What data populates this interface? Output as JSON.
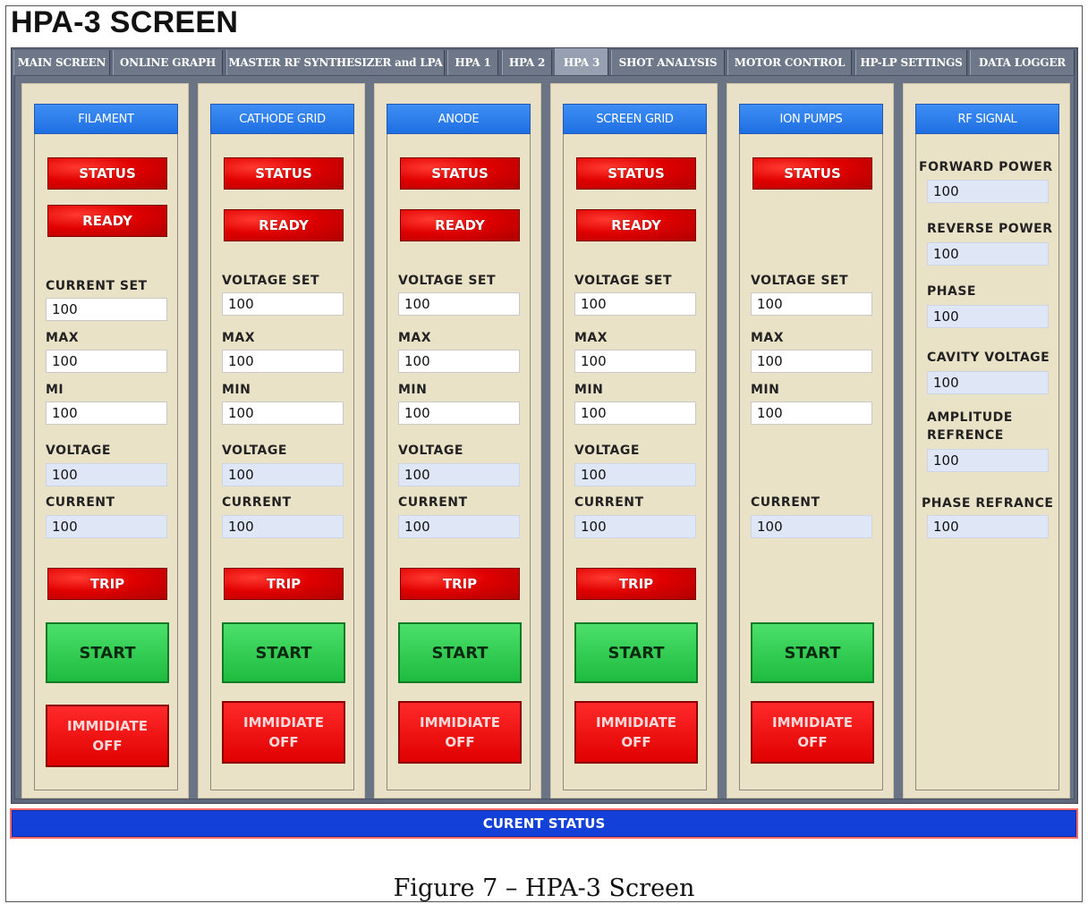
{
  "app": {
    "title": "HPA-3 SCREEN"
  },
  "tabs": [
    {
      "label": "MAIN SCREEN"
    },
    {
      "label": "ONLINE GRAPH"
    },
    {
      "label": "MASTER RF SYNTHESIZER and LPA"
    },
    {
      "label": "HPA 1"
    },
    {
      "label": "HPA 2"
    },
    {
      "label": "HPA 3",
      "active": true
    },
    {
      "label": "SHOT ANALYSIS"
    },
    {
      "label": "MOTOR CONTROL"
    },
    {
      "label": "HP-LP SETTINGS"
    },
    {
      "label": "DATA LOGGER"
    }
  ],
  "panels": [
    {
      "title": "FILAMENT",
      "status_label": "STATUS",
      "ready_label": "READY",
      "fields": [
        {
          "label": "CURRENT SET",
          "value": "100"
        },
        {
          "label": "MAX",
          "value": "100"
        },
        {
          "label": "MI",
          "value": "100"
        }
      ],
      "readouts": [
        {
          "label": "VOLTAGE",
          "value": "100"
        },
        {
          "label": "CURRENT",
          "value": "100"
        }
      ],
      "trip_label": "TRIP",
      "start_label": "START",
      "off_label": "IMMIDIATE\nOFF"
    },
    {
      "title": "CATHODE GRID",
      "status_label": "STATUS",
      "ready_label": "READY",
      "fields": [
        {
          "label": "VOLTAGE SET",
          "value": "100"
        },
        {
          "label": "MAX",
          "value": "100"
        },
        {
          "label": "MIN",
          "value": "100"
        }
      ],
      "readouts": [
        {
          "label": "VOLTAGE",
          "value": "100"
        },
        {
          "label": "CURRENT",
          "value": "100"
        }
      ],
      "trip_label": "TRIP",
      "start_label": "START",
      "off_label": "IMMIDIATE\nOFF"
    },
    {
      "title": "ANODE",
      "status_label": "STATUS",
      "ready_label": "READY",
      "fields": [
        {
          "label": "VOLTAGE SET",
          "value": "100"
        },
        {
          "label": "MAX",
          "value": "100"
        },
        {
          "label": "MIN",
          "value": "100"
        }
      ],
      "readouts": [
        {
          "label": "VOLTAGE",
          "value": "100"
        },
        {
          "label": "CURRENT",
          "value": "100"
        }
      ],
      "trip_label": "TRIP",
      "start_label": "START",
      "off_label": "IMMIDIATE\nOFF"
    },
    {
      "title": "SCREEN GRID",
      "status_label": "STATUS",
      "ready_label": "READY",
      "fields": [
        {
          "label": "VOLTAGE SET",
          "value": "100"
        },
        {
          "label": "MAX",
          "value": "100"
        },
        {
          "label": "MIN",
          "value": "100"
        }
      ],
      "readouts": [
        {
          "label": "VOLTAGE",
          "value": "100"
        },
        {
          "label": "CURRENT",
          "value": "100"
        }
      ],
      "trip_label": "TRIP",
      "start_label": "START",
      "off_label": "IMMIDIATE\nOFF"
    },
    {
      "title": "ION PUMPS",
      "status_label": "STATUS",
      "fields": [
        {
          "label": "VOLTAGE SET",
          "value": "100"
        },
        {
          "label": "MAX",
          "value": "100"
        },
        {
          "label": "MIN",
          "value": "100"
        }
      ],
      "readouts": [
        {
          "label": "CURRENT",
          "value": "100"
        }
      ],
      "start_label": "START",
      "off_label": "IMMIDIATE\nOFF"
    }
  ],
  "rf_signal": {
    "title": "RF SIGNAL",
    "readouts": [
      {
        "label": "FORWARD POWER",
        "value": "100"
      },
      {
        "label": "REVERSE POWER",
        "value": "100"
      },
      {
        "label": "PHASE",
        "value": "100"
      },
      {
        "label": "CAVITY VOLTAGE",
        "value": "100"
      },
      {
        "label": "AMPLITUDE\nREFRENCE",
        "value": "100"
      },
      {
        "label": "PHASE REFRANCE",
        "value": "100"
      }
    ]
  },
  "status_bar": {
    "label": "CURENT STATUS"
  },
  "figure": {
    "caption": "Figure 7 – HPA-3 Screen"
  }
}
